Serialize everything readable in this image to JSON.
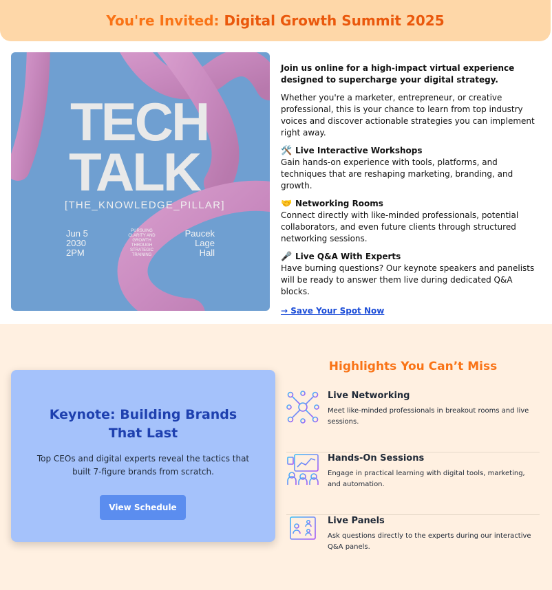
{
  "header": {
    "prefix": "You're Invited:",
    "event_name": "Digital Growth Summit 2025"
  },
  "poster": {
    "title_line1": "TECH",
    "title_line2": "TALK",
    "subtitle": "[THE_KNOWLEDGE_PILLAR]",
    "date_lines": [
      "Jun 5",
      "2030",
      "2PM"
    ],
    "tagline_lines": [
      "PURSUING",
      "CLARITY AND",
      "GROWTH",
      "THROUGH",
      "STRATEGIC",
      "TRAINING"
    ],
    "venue_lines": [
      "Paucek",
      "Lage",
      "Hall"
    ]
  },
  "intro": {
    "lead": "Join us online for a high-impact virtual experience designed to supercharge your digital strategy.",
    "body": "Whether you're a marketer, entrepreneur, or creative professional, this is your chance to learn from top industry voices and discover actionable strategies you can implement right away.",
    "features": [
      {
        "icon": "🛠️",
        "title": "Live Interactive Workshops",
        "text": "Gain hands-on experience with tools, platforms, and techniques that are reshaping marketing, branding, and growth."
      },
      {
        "icon": "🤝",
        "title": "Networking Rooms",
        "text": "Connect directly with like-minded professionals, potential collaborators, and even future clients through structured networking sessions."
      },
      {
        "icon": "🎤",
        "title": "Live Q&A With Experts",
        "text": "Have burning questions? Our keynote speakers and panelists will be ready to answer them live during dedicated Q&A blocks."
      }
    ],
    "cta": "→ Save Your Spot Now"
  },
  "keynote": {
    "title": "Keynote: Building Brands That Last",
    "description": "Top CEOs and digital experts reveal the tactics that built 7-figure brands from scratch.",
    "button": "View Schedule"
  },
  "highlights": {
    "title": "Highlights You Can’t Miss",
    "items": [
      {
        "icon": "network-icon",
        "title": "Live Networking",
        "text": "Meet like-minded professionals in breakout rooms and live sessions."
      },
      {
        "icon": "presentation-icon",
        "title": "Hands-On Sessions",
        "text": "Engage in practical learning with digital tools, marketing, and automation."
      },
      {
        "icon": "video-call-icon",
        "title": "Live Panels",
        "text": "Ask questions directly to the experts during our interactive Q&A panels."
      }
    ]
  }
}
